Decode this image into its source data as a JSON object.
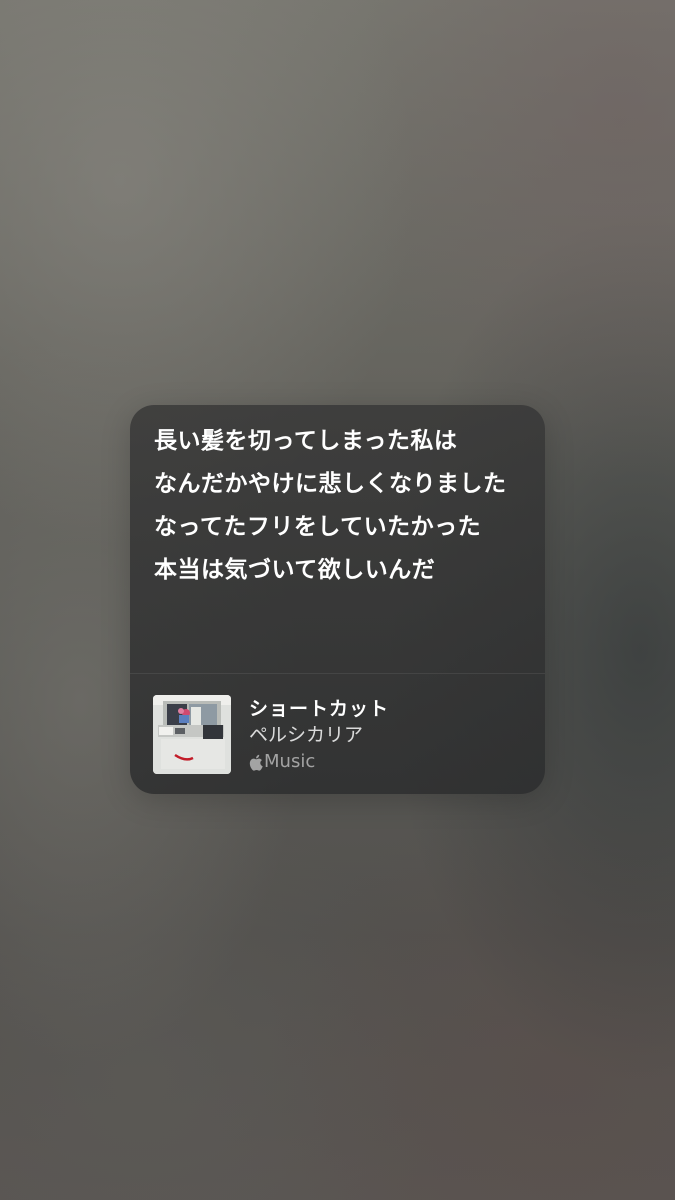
{
  "lyrics_card": {
    "lines": [
      "長い髪を切ってしまった私は",
      "なんだかやけに悲しくなりました",
      "なってたフリをしていたかった",
      "本当は気づいて欲しいんだ"
    ]
  },
  "song": {
    "title": "ショートカット",
    "artist": "ペルシカリア",
    "service": "Music",
    "artwork_icon": "album-artwork",
    "service_icon": "apple-logo-icon"
  },
  "colors": {
    "card_background": "#2e2f30",
    "text_primary": "#ffffff",
    "text_secondary": "#d0d0d0",
    "text_tertiary": "#8c8c8c"
  }
}
